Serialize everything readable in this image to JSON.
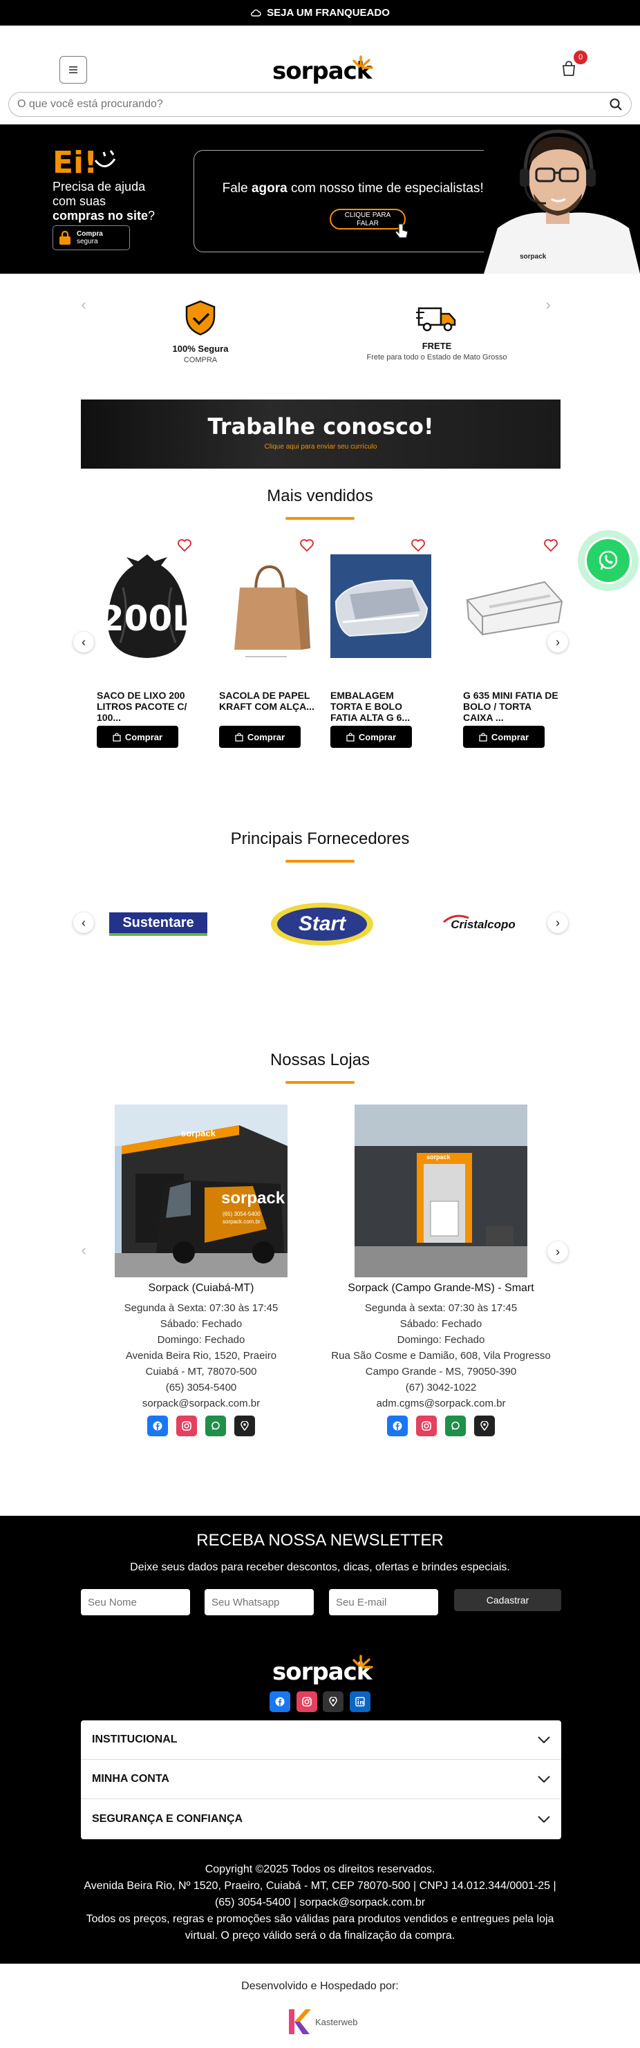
{
  "topbar": {
    "label": "SEJA UM FRANQUEADO"
  },
  "header": {
    "logo": "sorpack",
    "cart_count": "0",
    "search_placeholder": "O que você está procurando?"
  },
  "hero": {
    "ei": "Ei!",
    "help_1": "Precisa de ajuda",
    "help_2": "com suas",
    "help_bold": "compras no site",
    "help_q": "?",
    "secure_1": "Compra",
    "secure_2": "segura",
    "talk_pre": "Fale ",
    "talk_bold": "agora",
    "talk_post": " com nosso time de especialistas!!!",
    "cta_1": "CLIQUE PARA",
    "cta_2": "FALAR",
    "shirt_logo": "sorpack"
  },
  "features": [
    {
      "title": "100% Segura",
      "subtitle": "COMPRA",
      "icon": "shield-check-icon"
    },
    {
      "title": "FRETE",
      "subtitle": "Frete para todo o Estado de Mato Grosso",
      "icon": "truck-icon"
    }
  ],
  "banner": {
    "title": "Trabalhe conosco!",
    "subtitle": "Clique aqui para enviar seu currículo"
  },
  "best_sellers": {
    "title": "Mais vendidos",
    "buy_label": "Comprar",
    "products": [
      {
        "name": "SACO DE LIXO 200 LITROS PACOTE C/ 100...",
        "img_text": "200L"
      },
      {
        "name": "SACOLA DE PAPEL KRAFT COM ALÇA...",
        "img_text": ""
      },
      {
        "name": "EMBALAGEM TORTA E BOLO FATIA ALTA G 6...",
        "img_text": ""
      },
      {
        "name": "G 635 MINI FATIA DE BOLO / TORTA CAIXA ...",
        "img_text": ""
      }
    ]
  },
  "suppliers": {
    "title": "Principais Fornecedores",
    "items": [
      "Sustentare",
      "Start",
      "Cristalcopo"
    ]
  },
  "stores": {
    "title": "Nossas Lojas",
    "items": [
      {
        "name": "Sorpack (Cuiabá-MT)",
        "hours_1": "Segunda à Sexta: 07:30 às 17:45",
        "hours_2": "Sábado: Fechado",
        "hours_3": "Domingo: Fechado",
        "addr_1": "Avenida Beira Rio, 1520, Praeiro",
        "addr_2": "Cuiabá - MT, 78070-500",
        "phone": "(65) 3054-5400",
        "email": "sorpack@sorpack.com.br",
        "van_logo": "sorpack",
        "van_phone": "(65) 3054-5400",
        "van_site": "sorpack.com.br"
      },
      {
        "name": "Sorpack (Campo Grande-MS) - Smart",
        "hours_1": "Segunda à sexta: 07:30 às 17:45",
        "hours_2": "Sábado: Fechado",
        "hours_3": "Domingo: Fechado",
        "addr_1": "Rua São Cosme e Damião, 608, Vila Progresso",
        "addr_2": "Campo Grande - MS, 79050-390",
        "phone": "(67) 3042-1022",
        "email": "adm.cgms@sorpack.com.br",
        "building_logo": "sorpack"
      }
    ]
  },
  "newsletter": {
    "title": "RECEBA NOSSA NEWSLETTER",
    "subtitle": "Deixe seus dados para receber descontos, dicas, ofertas e brindes especiais.",
    "name_placeholder": "Seu Nome",
    "whatsapp_placeholder": "Seu Whatsapp",
    "email_placeholder": "Seu E-mail",
    "submit": "Cadastrar"
  },
  "footer": {
    "logo": "sorpack",
    "accordion": [
      "INSTITUCIONAL",
      "MINHA CONTA",
      "SEGURANÇA E CONFIANÇA"
    ],
    "copyright": "Copyright ©2025 Todos os direitos reservados.",
    "address": "Avenida Beira Rio, Nº 1520, Praeiro, Cuiabá - MT, CEP 78070-500 | CNPJ 14.012.344/0001-25 |",
    "contact": "(65) 3054-5400 | sorpack@sorpack.com.br",
    "notice_1": "Todos os preços, regras e promoções são válidas para produtos vendidos e entregues pela loja",
    "notice_2": "virtual. O preço válido será o da finalização da compra."
  },
  "dev": {
    "label": "Desenvolvido e Hospedado por:",
    "brand": "Kasterweb"
  },
  "colors": {
    "accent": "#f39200",
    "black": "#000000",
    "whatsapp": "#25d366",
    "facebook": "#1877f2",
    "instagram": "#e4405f",
    "linkedin": "#0a66c2"
  }
}
